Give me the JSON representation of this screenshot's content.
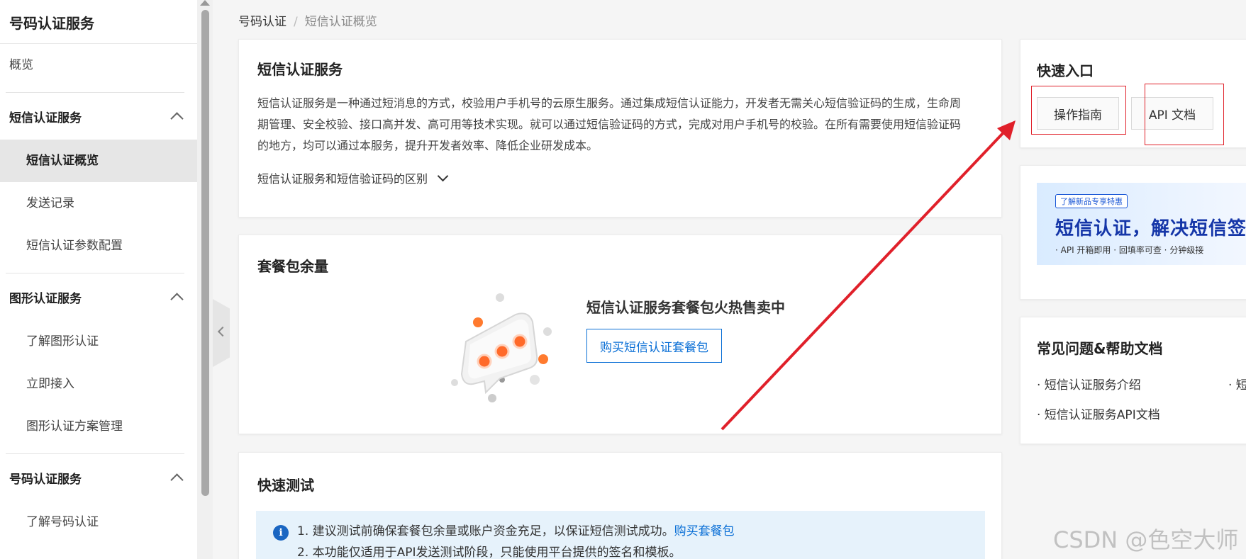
{
  "sidebar": {
    "title": "号码认证服务",
    "overview": "概览",
    "groups": [
      {
        "label": "短信认证服务",
        "items": [
          "短信认证概览",
          "发送记录",
          "短信认证参数配置"
        ],
        "active_item": "短信认证概览"
      },
      {
        "label": "图形认证服务",
        "items": [
          "了解图形认证",
          "立即接入",
          "图形认证方案管理"
        ]
      },
      {
        "label": "号码认证服务",
        "items": [
          "了解号码认证"
        ]
      }
    ]
  },
  "breadcrumb": {
    "root": "号码认证",
    "separator": "/",
    "current": "短信认证概览"
  },
  "intro": {
    "title": "短信认证服务",
    "description": "短信认证服务是一种通过短消息的方式，校验用户手机号的云原生服务。通过集成短信认证能力，开发者无需关心短信验证码的生成，生命周期管理、安全校验、接口高并发、高可用等技术实现。就可以通过短信验证码的方式，完成对用户手机号的校验。在所有需要使用短信验证码的地方，均可以通过本服务，提升开发者效率、降低企业研发成本。",
    "toggle_label": "短信认证服务和短信验证码的区别"
  },
  "package": {
    "title": "套餐包余量",
    "headline": "短信认证服务套餐包火热售卖中",
    "buy_button": "购买短信认证套餐包"
  },
  "quick_test": {
    "title": "快速测试",
    "note1": "1. 建议测试前确保套餐包余量或账户资金充足，以保证短信测试成功。",
    "note1_link": "购买套餐包",
    "note2": "2. 本功能仅适用于API发送测试阶段，只能使用平台提供的签名和模板。"
  },
  "quick_entry": {
    "title": "快速入口",
    "buttons": [
      "操作指南",
      "API 文档"
    ]
  },
  "promo": {
    "tag": "了解新品专享特惠",
    "headline": "短信认证，解决短信签名",
    "features": "· API 开箱即用    · 回填率可查    · 分钟级接"
  },
  "faq": {
    "title": "常见问题&帮助文档",
    "links": [
      "· 短信认证服务介绍",
      "· 短",
      "· 短信认证服务API文档"
    ]
  },
  "watermark": "CSDN @色空大师",
  "colors": {
    "accent": "#0a6fd6",
    "annotation": "#e0202a",
    "info_bg": "#e6f2fb"
  }
}
